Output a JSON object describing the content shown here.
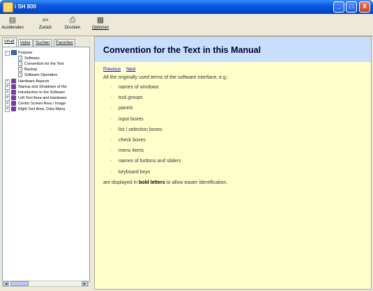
{
  "window": {
    "title": "i SH 800",
    "caption_buttons": {
      "minimize": "_",
      "maximize": "□",
      "close": "X"
    }
  },
  "toolbar": {
    "buttons": [
      {
        "label": "Ausblenden",
        "icon": "hide-pane-icon"
      },
      {
        "label": "Zurück",
        "icon": "back-arrow-icon"
      },
      {
        "label": "Drucken",
        "icon": "printer-icon"
      },
      {
        "label": "Optionen",
        "icon": "options-icon"
      }
    ]
  },
  "tabs": [
    "Inhalt",
    "Index",
    "Suchen",
    "Favoriten"
  ],
  "tree": [
    {
      "label": "Purpose",
      "level": 0,
      "type": "book-open",
      "expander": "-"
    },
    {
      "label": "Software",
      "level": 1,
      "type": "page"
    },
    {
      "label": "Convention for the Text",
      "level": 1,
      "type": "page",
      "selected": true
    },
    {
      "label": "Backup",
      "level": 1,
      "type": "page"
    },
    {
      "label": "Software Operation",
      "level": 1,
      "type": "page"
    },
    {
      "label": "Hardware Aspects",
      "level": 0,
      "type": "book",
      "expander": "+"
    },
    {
      "label": "Startup and Shutdown of the",
      "level": 0,
      "type": "book",
      "expander": "+"
    },
    {
      "label": "Introduction to the Software",
      "level": 0,
      "type": "book",
      "expander": "+"
    },
    {
      "label": "Left Tool Area and Hardware",
      "level": 0,
      "type": "book",
      "expander": "+"
    },
    {
      "label": "Center Screen Area / Image",
      "level": 0,
      "type": "book",
      "expander": "+"
    },
    {
      "label": "Right Tool Area, Data Mana",
      "level": 0,
      "type": "book",
      "expander": "+"
    }
  ],
  "page": {
    "title": "Convention for the Text in this Manual",
    "nav": {
      "previous": "Previous",
      "next": "Next"
    },
    "intro": "All the originally used terms of the software interface, e.g.:",
    "bullet": "-",
    "terms": [
      "names of windows",
      "tool groups",
      "panels",
      "input boxes",
      "list / selection boxes",
      "check boxes",
      "menu items",
      "names of buttons and sliders",
      "keyboard keys"
    ],
    "outro_before": "are displayed in ",
    "outro_bold": "bold letters",
    "outro_after": " to allow easier identification."
  },
  "colors": {
    "titlebar": "#0a5be0",
    "header_band": "#c8dffb",
    "content_bg": "#ffffcc",
    "book_closed": "#7a3aa0",
    "link": "#0000ee"
  }
}
